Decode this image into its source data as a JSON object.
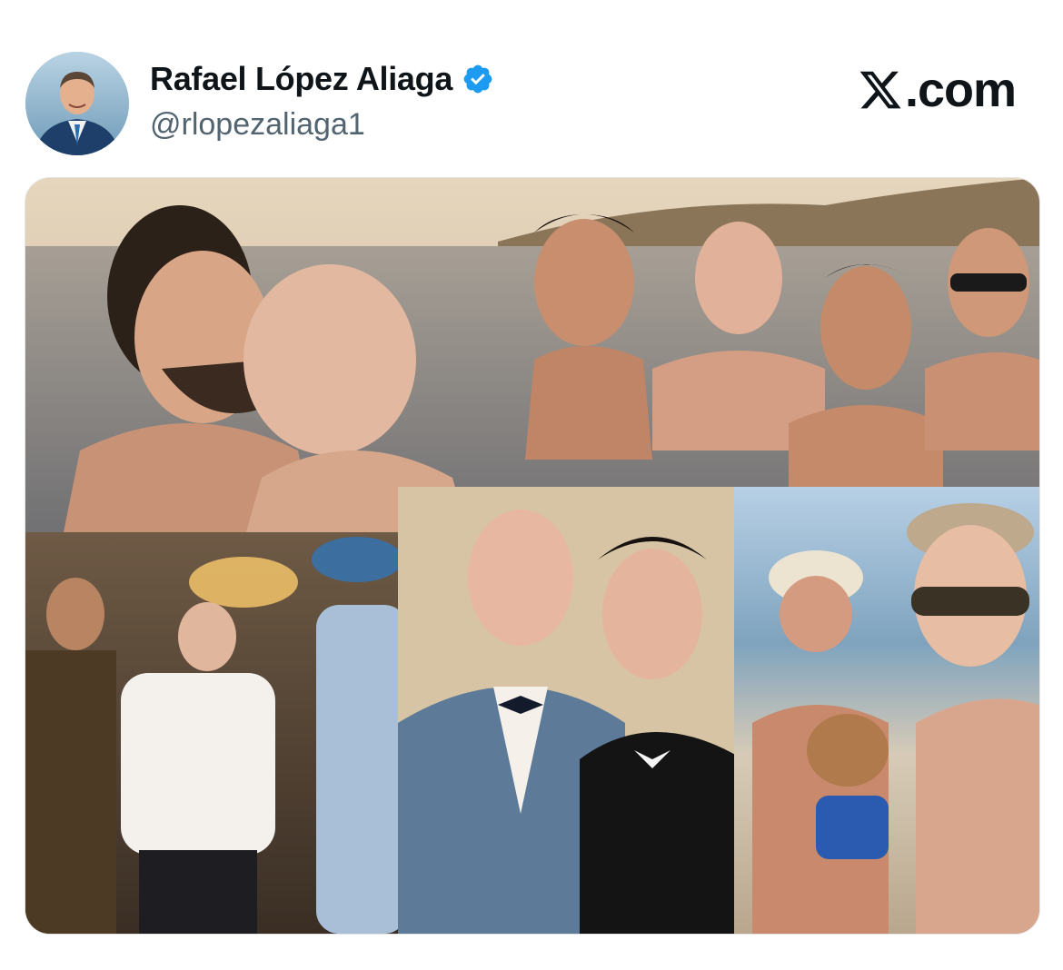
{
  "tweet": {
    "author": {
      "display_name": "Rafael López Aliaga",
      "handle": "@rlopezaliaga1",
      "verified": true,
      "avatar_icon": "profile-photo"
    },
    "brand": {
      "text": ".com",
      "logo_icon": "x-logo-icon"
    },
    "media": {
      "type": "photo-collage",
      "panels": [
        "beach-kiss",
        "ocean-group",
        "party-room",
        "formal-portrait",
        "beach-with-dogs"
      ]
    },
    "colors": {
      "verified_blue": "#1d9bf0",
      "handle_gray": "#536471",
      "text": "#0f1419"
    }
  }
}
